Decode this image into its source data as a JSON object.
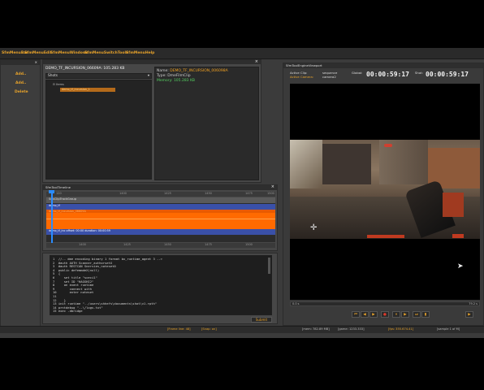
{
  "menu": [
    "SfmMenuBar",
    "SfmMenuEdit",
    "SfmMenuWindows",
    "SfmMenuSwitchTools",
    "SfmMenuHelp"
  ],
  "side_buttons": [
    "Add..",
    "Add..",
    "Delete"
  ],
  "clip_browser": {
    "title": "DEMO_TF_INCURSION_06609A: 105.283 KB",
    "dropdown": "Shots",
    "tree_root": "Items",
    "tree_item": "demo_tf_incursion_1"
  },
  "properties": {
    "name_label": "Name:",
    "name_value": "DEMO_TF_INCURSION_006098A",
    "type_label": "Type:",
    "type_value": "DmeFilmClip",
    "memory_label": "Memory:",
    "memory_value": "105.283 KB"
  },
  "timeline": {
    "title": "SfmToolTimeline",
    "ticks_top": [
      "120",
      "1400",
      "1425",
      "1450",
      "1475",
      "1500"
    ],
    "ticks_bottom": [
      "1400",
      "1425",
      "1450",
      "1475",
      "1500"
    ],
    "track_group": "SubClipTrackGroup",
    "clip_top": "demo_tf",
    "clip_label": "demo_tf_incursion_06609A",
    "clip_info": "demo_tf_inc  offset: 00:00  duration: 00:00:59"
  },
  "script": {
    "lines": [
      "1  //-- dme encoding binary 1 format bx_runtime_agent 3 -->",
      "2  #auth AUTH Scanner_authorsetX",
      "3  #auth RESTCAN Snervies_noteset0",
      "4  public defemmdeX(null)",
      "5  {",
      "6     set title \"sceci1\"",
      "7     set ID \"HAGSHI2\"",
      "8     on event runtime",
      "9        connect with",
      "10       enter noteset",
      "11       ",
      "12    }",
      "13 init runtime \"../users\\shhefs\\documents\\shot\\v1.rpth\"",
      "14 prntdebug \"..\\/logs.txt\"",
      "15 exec -dbridge"
    ],
    "submit_label": "Submit"
  },
  "bottom_status": {
    "frame": "[Frame line: 48]",
    "snap": "[Snap: on]",
    "mem": "[mem: 782.89 MB]",
    "game": "[game: 1233.333]",
    "fps": "[fps: 355.674.41]",
    "sample": "[sample 1 of M]"
  },
  "viewport": {
    "title": "SfmToolEngineViewport",
    "active_clip_label": "Active Clip:",
    "active_clip_value": "sequence",
    "active_camera_label": "Active Camera:",
    "active_camera_value": "camera2",
    "global_label": "Global:",
    "global_time": "00:00:59:17",
    "shot_label": "Shot:",
    "shot_time": "00:00:59:17",
    "scrub_left": "0.0 s",
    "scrub_right": "79.2 s",
    "scrub_progress": 0.0
  },
  "transport": [
    "⏮",
    "◀",
    "▶",
    "●",
    "⏸",
    "▶",
    "⏭",
    "▮",
    "▶"
  ],
  "colors": {
    "accent": "#e8a32a",
    "timeline_blue": "#3a50a8",
    "timeline_orange": "#ff6a00",
    "playhead": "#2a8cff"
  }
}
